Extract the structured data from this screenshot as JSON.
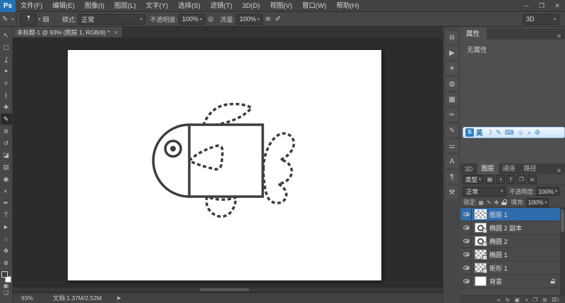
{
  "menubar": {
    "logo": "Ps",
    "items": [
      {
        "label": "文件(F)"
      },
      {
        "label": "编辑(E)"
      },
      {
        "label": "图像(I)"
      },
      {
        "label": "图层(L)"
      },
      {
        "label": "文字(Y)"
      },
      {
        "label": "选择(S)"
      },
      {
        "label": "滤镜(T)"
      },
      {
        "label": "3D(D)"
      },
      {
        "label": "视图(V)"
      },
      {
        "label": "窗口(W)"
      },
      {
        "label": "帮助(H)"
      }
    ],
    "window_buttons": [
      {
        "name": "minimize",
        "glyph": "─"
      },
      {
        "name": "restore",
        "glyph": "❐"
      },
      {
        "name": "close",
        "glyph": "✕"
      }
    ]
  },
  "optionsbar": {
    "brush_tool_glyph": "✎",
    "brush_size": "7",
    "panel_toggle_glyph": "▤",
    "mode_label": "模式:",
    "mode_value": "正常",
    "opacity_label": "不透明度:",
    "opacity_value": "100%",
    "pressure_glyph": "◎",
    "flow_label": "流量:",
    "flow_value": "100%",
    "airbrush_glyph": "≋",
    "pen_pressure_glyph": "✐",
    "workspace_value": "3D"
  },
  "document_tab": {
    "title": "未标题-1 @ 93% (图层 1, RGB/8) *",
    "close": "×"
  },
  "toolbar": {
    "tools": [
      {
        "name": "move-tool",
        "glyph": "↖"
      },
      {
        "name": "marquee-tool",
        "glyph": "▢"
      },
      {
        "name": "lasso-tool",
        "glyph": "ʆ"
      },
      {
        "name": "quick-selection-tool",
        "glyph": "✦"
      },
      {
        "name": "crop-tool",
        "glyph": "⌗"
      },
      {
        "name": "eyedropper-tool",
        "glyph": "∤"
      },
      {
        "name": "spot-healing-tool",
        "glyph": "✚"
      },
      {
        "name": "brush-tool",
        "glyph": "✎"
      },
      {
        "name": "clone-stamp-tool",
        "glyph": "⊛"
      },
      {
        "name": "history-brush-tool",
        "glyph": "↺"
      },
      {
        "name": "eraser-tool",
        "glyph": "◪"
      },
      {
        "name": "gradient-tool",
        "glyph": "▤"
      },
      {
        "name": "blur-tool",
        "glyph": "◉"
      },
      {
        "name": "dodge-tool",
        "glyph": "◐"
      },
      {
        "name": "pen-tool",
        "glyph": "✒"
      },
      {
        "name": "type-tool",
        "glyph": "T"
      },
      {
        "name": "path-selection-tool",
        "glyph": "►"
      },
      {
        "name": "shape-tool",
        "glyph": "○"
      },
      {
        "name": "hand-tool",
        "glyph": "✥"
      },
      {
        "name": "zoom-tool",
        "glyph": "⊕"
      }
    ],
    "quick_mask_glyph": "▣",
    "screen_mode_glyph": "❏"
  },
  "dock": {
    "icons": [
      {
        "name": "info-panel-icon",
        "glyph": "⧉"
      },
      {
        "name": "actions-panel-icon",
        "glyph": "▶"
      },
      {
        "name": "adjustments-panel-icon",
        "glyph": "☀"
      },
      {
        "name": "styles-panel-icon",
        "glyph": "◍"
      },
      {
        "name": "channels-panel-icon",
        "glyph": "▦"
      },
      {
        "name": "brush-presets-panel-icon",
        "glyph": "✑"
      },
      {
        "name": "brush-panel-icon",
        "glyph": "✎"
      },
      {
        "name": "clone-source-panel-icon",
        "glyph": "⚍"
      },
      {
        "name": "character-panel-icon",
        "glyph": "A"
      },
      {
        "name": "paragraph-panel-icon",
        "glyph": "¶"
      },
      {
        "name": "tool-presets-panel-icon",
        "glyph": "⚒"
      }
    ]
  },
  "properties_panel": {
    "tab": "属性",
    "menu_glyph": "≡",
    "empty_text": "无属性"
  },
  "ime_bar": {
    "logo": "S",
    "mode": "英",
    "icons": [
      {
        "name": "handwriting-icon",
        "glyph": "☽"
      },
      {
        "name": "pen-icon",
        "glyph": "✎"
      },
      {
        "name": "keyboard-icon",
        "glyph": "⌨"
      },
      {
        "name": "skin-icon",
        "glyph": "☺"
      },
      {
        "name": "search-icon",
        "glyph": "⌕"
      },
      {
        "name": "settings-icon",
        "glyph": "⚙"
      }
    ]
  },
  "layers_panel": {
    "tabs": [
      "3D",
      "图层",
      "通道",
      "路径"
    ],
    "menu_glyph": "≡",
    "filter_label": "类型",
    "filter_icons": [
      {
        "name": "filter-pixel-icon",
        "glyph": "▦"
      },
      {
        "name": "filter-adjustment-icon",
        "glyph": "◑"
      },
      {
        "name": "filter-type-icon",
        "glyph": "T"
      },
      {
        "name": "filter-shape-icon",
        "glyph": "❒"
      },
      {
        "name": "filter-smart-icon",
        "glyph": "⧈"
      }
    ],
    "blend_mode": "正常",
    "opacity_label": "不透明度:",
    "opacity_value": "100%",
    "lock_label": "锁定:",
    "lock_icons": [
      {
        "name": "lock-transparency-icon",
        "glyph": "▦"
      },
      {
        "name": "lock-pixels-icon",
        "glyph": "✎"
      },
      {
        "name": "lock-position-icon",
        "glyph": "✥"
      }
    ],
    "fill_label": "填充:",
    "fill_value": "100%",
    "layers": [
      {
        "name": "图层 1"
      },
      {
        "name": "椭圆 2 副本"
      },
      {
        "name": "椭圆 2"
      },
      {
        "name": "椭圆 1"
      },
      {
        "name": "矩形 1"
      },
      {
        "name": "背景"
      }
    ],
    "bottom_icons": [
      {
        "name": "link-layers-icon",
        "glyph": "∞"
      },
      {
        "name": "layer-styles-icon",
        "glyph": "fx"
      },
      {
        "name": "add-mask-icon",
        "glyph": "▣"
      },
      {
        "name": "adjustment-layer-icon",
        "glyph": "◑"
      },
      {
        "name": "new-group-icon",
        "glyph": "❒"
      },
      {
        "name": "new-layer-icon",
        "glyph": "⊞"
      },
      {
        "name": "delete-layer-icon",
        "glyph": "⌦"
      }
    ]
  },
  "statusbar": {
    "zoom": "93%",
    "doc_info": "文档:1.37M/2.52M",
    "arrow": "▶"
  }
}
